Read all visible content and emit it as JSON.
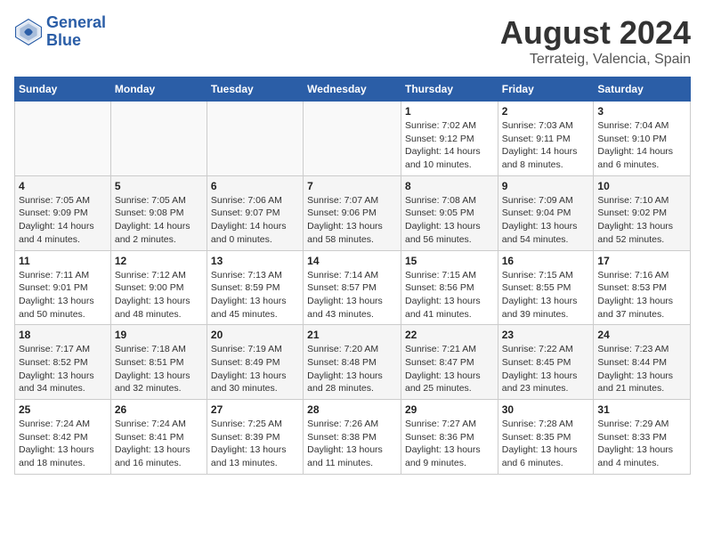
{
  "header": {
    "logo_line1": "General",
    "logo_line2": "Blue",
    "main_title": "August 2024",
    "subtitle": "Terrateig, Valencia, Spain"
  },
  "days_of_week": [
    "Sunday",
    "Monday",
    "Tuesday",
    "Wednesday",
    "Thursday",
    "Friday",
    "Saturday"
  ],
  "weeks": [
    [
      {
        "day": "",
        "info": ""
      },
      {
        "day": "",
        "info": ""
      },
      {
        "day": "",
        "info": ""
      },
      {
        "day": "",
        "info": ""
      },
      {
        "day": "1",
        "info": "Sunrise: 7:02 AM\nSunset: 9:12 PM\nDaylight: 14 hours\nand 10 minutes."
      },
      {
        "day": "2",
        "info": "Sunrise: 7:03 AM\nSunset: 9:11 PM\nDaylight: 14 hours\nand 8 minutes."
      },
      {
        "day": "3",
        "info": "Sunrise: 7:04 AM\nSunset: 9:10 PM\nDaylight: 14 hours\nand 6 minutes."
      }
    ],
    [
      {
        "day": "4",
        "info": "Sunrise: 7:05 AM\nSunset: 9:09 PM\nDaylight: 14 hours\nand 4 minutes."
      },
      {
        "day": "5",
        "info": "Sunrise: 7:05 AM\nSunset: 9:08 PM\nDaylight: 14 hours\nand 2 minutes."
      },
      {
        "day": "6",
        "info": "Sunrise: 7:06 AM\nSunset: 9:07 PM\nDaylight: 14 hours\nand 0 minutes."
      },
      {
        "day": "7",
        "info": "Sunrise: 7:07 AM\nSunset: 9:06 PM\nDaylight: 13 hours\nand 58 minutes."
      },
      {
        "day": "8",
        "info": "Sunrise: 7:08 AM\nSunset: 9:05 PM\nDaylight: 13 hours\nand 56 minutes."
      },
      {
        "day": "9",
        "info": "Sunrise: 7:09 AM\nSunset: 9:04 PM\nDaylight: 13 hours\nand 54 minutes."
      },
      {
        "day": "10",
        "info": "Sunrise: 7:10 AM\nSunset: 9:02 PM\nDaylight: 13 hours\nand 52 minutes."
      }
    ],
    [
      {
        "day": "11",
        "info": "Sunrise: 7:11 AM\nSunset: 9:01 PM\nDaylight: 13 hours\nand 50 minutes."
      },
      {
        "day": "12",
        "info": "Sunrise: 7:12 AM\nSunset: 9:00 PM\nDaylight: 13 hours\nand 48 minutes."
      },
      {
        "day": "13",
        "info": "Sunrise: 7:13 AM\nSunset: 8:59 PM\nDaylight: 13 hours\nand 45 minutes."
      },
      {
        "day": "14",
        "info": "Sunrise: 7:14 AM\nSunset: 8:57 PM\nDaylight: 13 hours\nand 43 minutes."
      },
      {
        "day": "15",
        "info": "Sunrise: 7:15 AM\nSunset: 8:56 PM\nDaylight: 13 hours\nand 41 minutes."
      },
      {
        "day": "16",
        "info": "Sunrise: 7:15 AM\nSunset: 8:55 PM\nDaylight: 13 hours\nand 39 minutes."
      },
      {
        "day": "17",
        "info": "Sunrise: 7:16 AM\nSunset: 8:53 PM\nDaylight: 13 hours\nand 37 minutes."
      }
    ],
    [
      {
        "day": "18",
        "info": "Sunrise: 7:17 AM\nSunset: 8:52 PM\nDaylight: 13 hours\nand 34 minutes."
      },
      {
        "day": "19",
        "info": "Sunrise: 7:18 AM\nSunset: 8:51 PM\nDaylight: 13 hours\nand 32 minutes."
      },
      {
        "day": "20",
        "info": "Sunrise: 7:19 AM\nSunset: 8:49 PM\nDaylight: 13 hours\nand 30 minutes."
      },
      {
        "day": "21",
        "info": "Sunrise: 7:20 AM\nSunset: 8:48 PM\nDaylight: 13 hours\nand 28 minutes."
      },
      {
        "day": "22",
        "info": "Sunrise: 7:21 AM\nSunset: 8:47 PM\nDaylight: 13 hours\nand 25 minutes."
      },
      {
        "day": "23",
        "info": "Sunrise: 7:22 AM\nSunset: 8:45 PM\nDaylight: 13 hours\nand 23 minutes."
      },
      {
        "day": "24",
        "info": "Sunrise: 7:23 AM\nSunset: 8:44 PM\nDaylight: 13 hours\nand 21 minutes."
      }
    ],
    [
      {
        "day": "25",
        "info": "Sunrise: 7:24 AM\nSunset: 8:42 PM\nDaylight: 13 hours\nand 18 minutes."
      },
      {
        "day": "26",
        "info": "Sunrise: 7:24 AM\nSunset: 8:41 PM\nDaylight: 13 hours\nand 16 minutes."
      },
      {
        "day": "27",
        "info": "Sunrise: 7:25 AM\nSunset: 8:39 PM\nDaylight: 13 hours\nand 13 minutes."
      },
      {
        "day": "28",
        "info": "Sunrise: 7:26 AM\nSunset: 8:38 PM\nDaylight: 13 hours\nand 11 minutes."
      },
      {
        "day": "29",
        "info": "Sunrise: 7:27 AM\nSunset: 8:36 PM\nDaylight: 13 hours\nand 9 minutes."
      },
      {
        "day": "30",
        "info": "Sunrise: 7:28 AM\nSunset: 8:35 PM\nDaylight: 13 hours\nand 6 minutes."
      },
      {
        "day": "31",
        "info": "Sunrise: 7:29 AM\nSunset: 8:33 PM\nDaylight: 13 hours\nand 4 minutes."
      }
    ]
  ]
}
